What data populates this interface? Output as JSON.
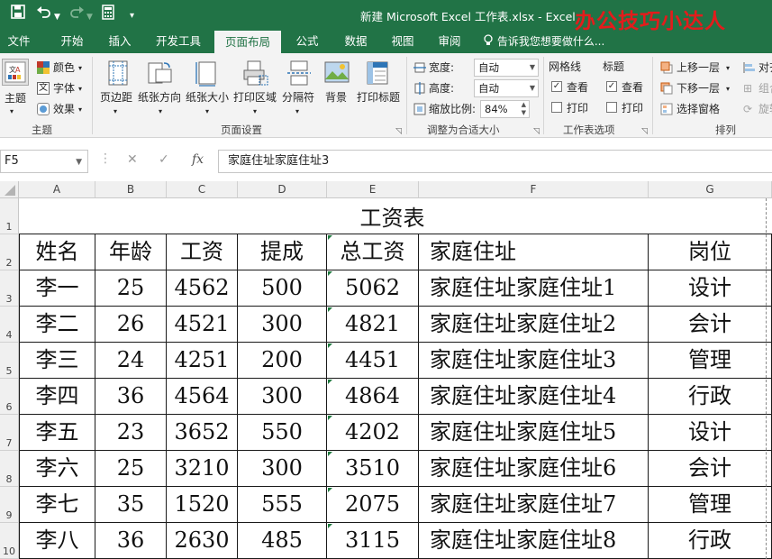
{
  "window": {
    "title": "新建 Microsoft Excel 工作表.xlsx - Excel"
  },
  "watermark": "办公技巧小达人",
  "tabs": [
    "文件",
    "开始",
    "插入",
    "开发工具",
    "页面布局",
    "公式",
    "数据",
    "视图",
    "审阅"
  ],
  "active_tab": "页面布局",
  "tell_me": "告诉我您想要做什么...",
  "ribbon": {
    "theme": {
      "themes_label": "主题",
      "colors_label": "颜色",
      "fonts_label": "字体",
      "effects_label": "效果",
      "group_label": "主题"
    },
    "page_setup": {
      "margins": "页边距",
      "orientation": "纸张方向",
      "size": "纸张大小",
      "print_area": "打印区域",
      "breaks": "分隔符",
      "background": "背景",
      "print_titles": "打印标题",
      "group_label": "页面设置"
    },
    "scale": {
      "width_label": "宽度:",
      "width_value": "自动",
      "height_label": "高度:",
      "height_value": "自动",
      "scale_label": "缩放比例:",
      "scale_value": "84%",
      "group_label": "调整为合适大小"
    },
    "sheet_options": {
      "gridlines": "网格线",
      "headings": "标题",
      "view": "查看",
      "print": "打印",
      "gridlines_view_checked": true,
      "gridlines_print_checked": false,
      "headings_view_checked": true,
      "headings_print_checked": false,
      "group_label": "工作表选项"
    },
    "arrange": {
      "bring_forward": "上移一层",
      "send_backward": "下移一层",
      "selection_pane": "选择窗格",
      "align": "对齐",
      "group": "组合",
      "rotate": "旋转",
      "group_label": "排列"
    }
  },
  "formula_bar": {
    "name_box": "F5",
    "cancel": "✕",
    "enter": "✓",
    "fx": "fx",
    "content": "家庭住址家庭住址3"
  },
  "columns": [
    "A",
    "B",
    "C",
    "D",
    "E",
    "F",
    "G"
  ],
  "row_numbers": [
    "1",
    "2",
    "3",
    "4",
    "5",
    "6",
    "7",
    "8",
    "9",
    "10"
  ],
  "sheet": {
    "title": "工资表",
    "headers": [
      "姓名",
      "年龄",
      "工资",
      "提成",
      "总工资",
      "家庭住址",
      "岗位"
    ],
    "rows": [
      [
        "李一",
        "25",
        "4562",
        "500",
        "5062",
        "家庭住址家庭住址1",
        "设计"
      ],
      [
        "李二",
        "26",
        "4521",
        "300",
        "4821",
        "家庭住址家庭住址2",
        "会计"
      ],
      [
        "李三",
        "24",
        "4251",
        "200",
        "4451",
        "家庭住址家庭住址3",
        "管理"
      ],
      [
        "李四",
        "36",
        "4564",
        "300",
        "4864",
        "家庭住址家庭住址4",
        "行政"
      ],
      [
        "李五",
        "23",
        "3652",
        "550",
        "4202",
        "家庭住址家庭住址5",
        "设计"
      ],
      [
        "李六",
        "25",
        "3210",
        "300",
        "3510",
        "家庭住址家庭住址6",
        "会计"
      ],
      [
        "李七",
        "35",
        "1520",
        "555",
        "2075",
        "家庭住址家庭住址7",
        "管理"
      ],
      [
        "李八",
        "36",
        "2630",
        "485",
        "3115",
        "家庭住址家庭住址8",
        "行政"
      ]
    ]
  },
  "colors": {
    "excel_green": "#217346",
    "watermark_red": "#e31c1c",
    "error_triangle": "#1f7a3f"
  }
}
